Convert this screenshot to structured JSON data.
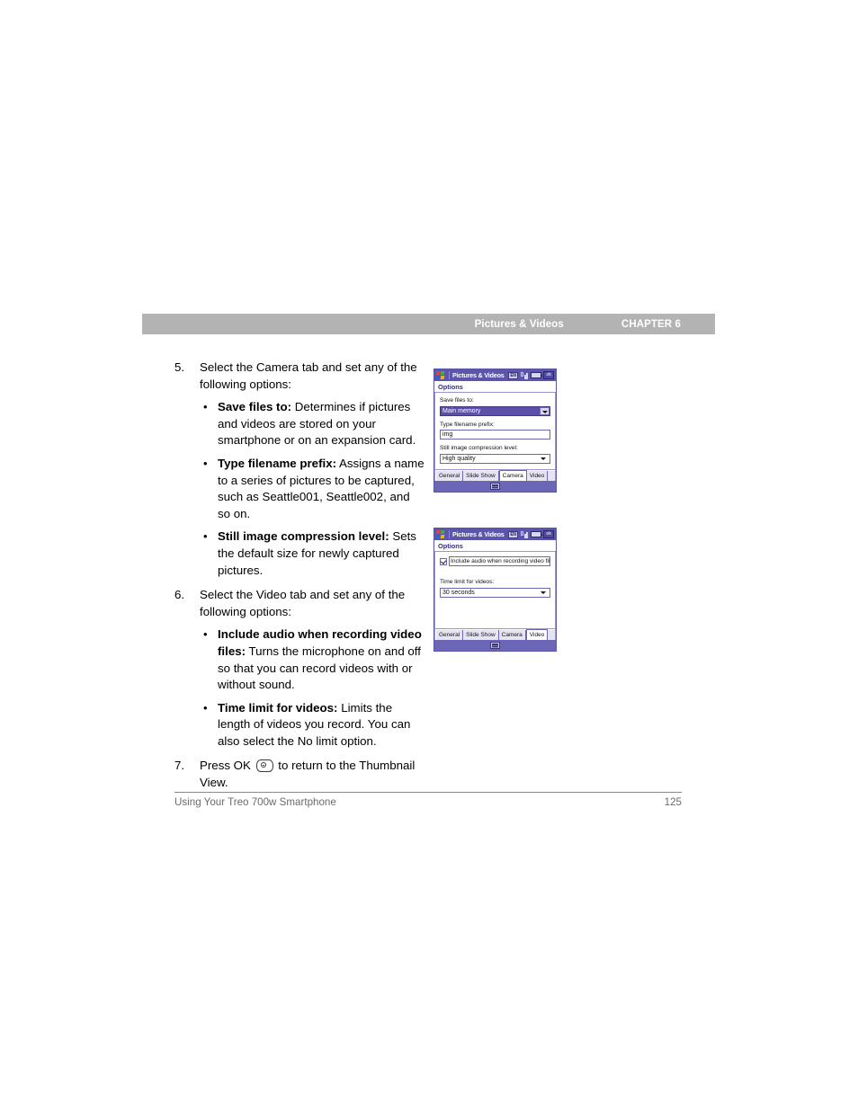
{
  "running_head": {
    "section": "Pictures & Videos",
    "chapter": "CHAPTER 6"
  },
  "steps": [
    {
      "number": "5.",
      "intro": "Select the Camera tab and set any of the following options:",
      "bullets": [
        {
          "dot": "•",
          "term": "Save files to:",
          "description": " Determines if pictures and videos are stored on your smartphone or on an expansion card."
        },
        {
          "dot": "•",
          "term": "Type filename prefix:",
          "description": " Assigns a name to a series of pictures to be captured, such as Seattle001, Seattle002, and so on."
        },
        {
          "dot": "•",
          "term": "Still image compression level:",
          "description": " Sets the default size for newly captured pictures."
        }
      ]
    },
    {
      "number": "6.",
      "intro": "Select the Video tab and set any of the following options:",
      "bullets": [
        {
          "dot": "•",
          "term": "Include audio when recording video files:",
          "description": " Turns the microphone on and off so that you can record videos with or without sound."
        },
        {
          "dot": "•",
          "term": "Time limit for videos:",
          "description": " Limits the length of videos you record. You can also select the No limit option."
        }
      ]
    },
    {
      "number": "7.",
      "intro_pre": "Press OK ",
      "intro_post": " to return to the Thumbnail View.",
      "ok_icon": "ok-button-icon",
      "bullets": []
    }
  ],
  "device_camera": {
    "titlebar": {
      "logo": "windows-mobile-logo-icon",
      "title": "Pictures & Videos",
      "icons": [
        {
          "name": "input-language-icon",
          "label": "EN"
        },
        {
          "name": "signal-strength-icon",
          "label": ""
        },
        {
          "name": "battery-icon",
          "label": ""
        },
        {
          "name": "ok-close-icon",
          "label": "ok"
        }
      ]
    },
    "menubar": "Options",
    "fields": [
      {
        "label": "Save files to:",
        "value": "Main memory",
        "control": "dropdown",
        "selected": true
      },
      {
        "label": "Type filename prefix:",
        "value": "img",
        "control": "textbox",
        "selected": false
      },
      {
        "label": "Still image compression level:",
        "value": "High quality",
        "control": "dropdown",
        "selected": false
      }
    ],
    "tabs": [
      {
        "label": "General",
        "active": false
      },
      {
        "label": "Slide Show",
        "active": false
      },
      {
        "label": "Camera",
        "active": true
      },
      {
        "label": "Video",
        "active": false
      }
    ],
    "cmdbar_icon": "input-panel-icon"
  },
  "device_video": {
    "titlebar": {
      "logo": "windows-mobile-logo-icon",
      "title": "Pictures & Videos",
      "icons": [
        {
          "name": "input-language-icon",
          "label": "EN"
        },
        {
          "name": "signal-strength-icon",
          "label": ""
        },
        {
          "name": "battery-icon",
          "label": ""
        },
        {
          "name": "ok-close-icon",
          "label": "ok"
        }
      ]
    },
    "menubar": "Options",
    "checkbox": {
      "label": "Include audio when recording video files.",
      "checked": true
    },
    "fields": [
      {
        "label": "Time limit for videos:",
        "value": "30 seconds",
        "control": "dropdown",
        "selected": false
      }
    ],
    "tabs": [
      {
        "label": "General",
        "active": false
      },
      {
        "label": "Slide Show",
        "active": false
      },
      {
        "label": "Camera",
        "active": false
      },
      {
        "label": "Video",
        "active": true
      }
    ],
    "cmdbar_icon": "input-panel-icon"
  },
  "footer": {
    "book_title": "Using Your Treo 700w Smartphone",
    "page_number": "125"
  },
  "colors": {
    "running_head_bg": "#b3b3b3",
    "device_chrome": "#6b66b5",
    "device_titlebar": "#5b56ab",
    "selection": "#5b4fa8",
    "menu_text": "#332e86",
    "footer_text": "#6b6b6b"
  }
}
